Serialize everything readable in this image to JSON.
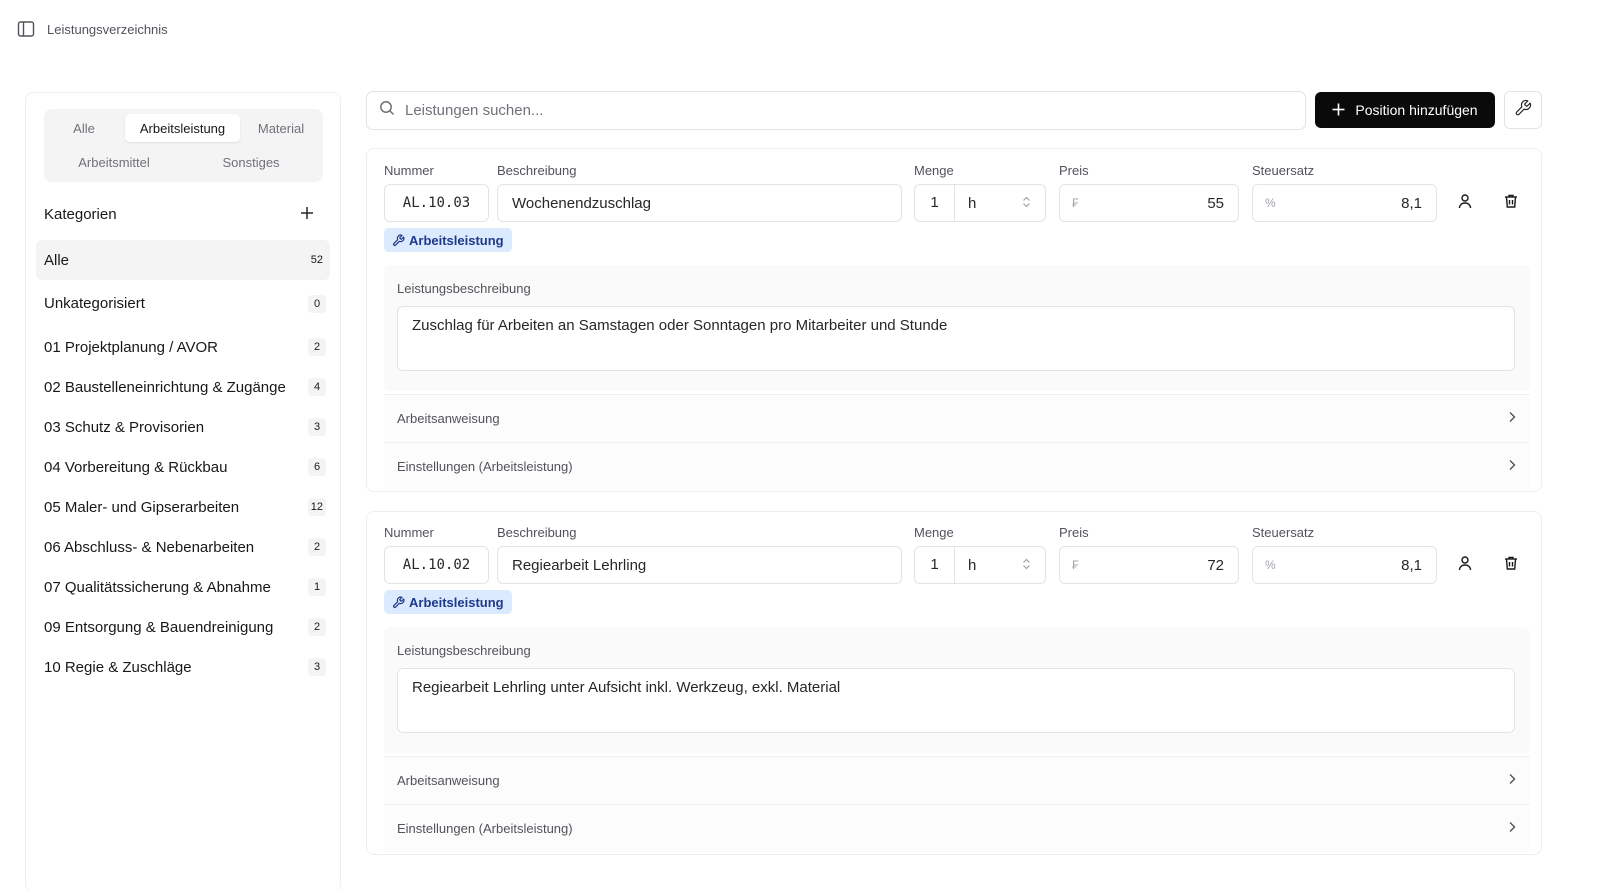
{
  "header": {
    "breadcrumb": "Leistungsverzeichnis"
  },
  "sidebar": {
    "tabs": [
      "Alle",
      "Arbeitsleistung",
      "Material",
      "Arbeitsmittel",
      "Sonstiges"
    ],
    "active_tab": "Arbeitsleistung",
    "categories_title": "Kategorien",
    "categories": [
      {
        "name": "Alle",
        "count": "52"
      },
      {
        "name": "Unkategorisiert",
        "count": "0"
      },
      {
        "name": "01 Projektplanung / AVOR",
        "count": "2"
      },
      {
        "name": "02 Baustelleneinrichtung & Zugänge",
        "count": "4"
      },
      {
        "name": "03 Schutz & Provisorien",
        "count": "3"
      },
      {
        "name": "04 Vorbereitung & Rückbau",
        "count": "6"
      },
      {
        "name": "05 Maler- und Gipserarbeiten",
        "count": "12"
      },
      {
        "name": "06 Abschluss- & Nebenarbeiten",
        "count": "2"
      },
      {
        "name": "07 Qualitätssicherung & Abnahme",
        "count": "1"
      },
      {
        "name": "09 Entsorgung & Bauendreinigung",
        "count": "2"
      },
      {
        "name": "10 Regie & Zuschläge",
        "count": "3"
      }
    ]
  },
  "toolbar": {
    "search_placeholder": "Leistungen suchen...",
    "add_label": "Position hinzufügen"
  },
  "labels": {
    "nummer": "Nummer",
    "beschreibung": "Beschreibung",
    "menge": "Menge",
    "preis": "Preis",
    "steuersatz": "Steuersatz",
    "leistungsbeschreibung": "Leistungsbeschreibung",
    "arbeitsanweisung": "Arbeitsanweisung",
    "einstellungen": "Einstellungen (Arbeitsleistung)",
    "currency_symbol": "₣",
    "percent_symbol": "%"
  },
  "positions": [
    {
      "nummer": "AL.10.03",
      "beschreibung": "Wochenendzuschlag",
      "menge": "1",
      "einheit": "h",
      "preis": "55",
      "steuersatz": "8,1",
      "typ": "Arbeitsleistung",
      "leistungsbeschreibung": "Zuschlag für Arbeiten an Samstagen oder Sonntagen pro Mitarbeiter und Stunde"
    },
    {
      "nummer": "AL.10.02",
      "beschreibung": "Regiearbeit Lehrling",
      "menge": "1",
      "einheit": "h",
      "preis": "72",
      "steuersatz": "8,1",
      "typ": "Arbeitsleistung",
      "leistungsbeschreibung": "Regiearbeit Lehrling unter Aufsicht inkl. Werkzeug, exkl. Material"
    }
  ],
  "colors": {
    "badge_bg": "#dbeafe",
    "badge_text": "#1e3a8a",
    "primary_button": "#0a0a0a"
  }
}
